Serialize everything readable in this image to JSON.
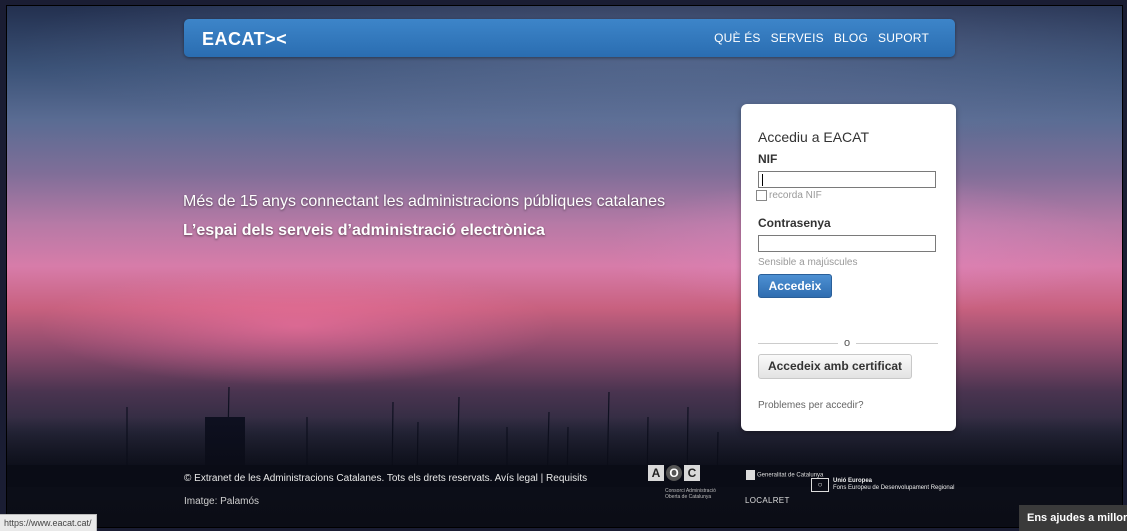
{
  "header": {
    "logo": "EACAT><",
    "nav": [
      "QUÈ ÉS",
      "SERVEIS",
      "BLOG",
      "SUPORT"
    ]
  },
  "hero": {
    "headline": "Més de 15 anys connectant les administracions públiques catalanes",
    "subheadline": "L’espai dels serveis d’administració electrònica"
  },
  "login": {
    "title": "Accediu a EACAT",
    "nif_label": "NIF",
    "nif_value": "",
    "remember_label": "recorda NIF",
    "password_label": "Contrasenya",
    "password_value": "",
    "case_hint": "Sensible a majúscules",
    "submit_label": "Accedeix",
    "divider_text": "o",
    "certificate_label": "Accedeix amb certificat",
    "problems_link": "Problemes per accedir?"
  },
  "footer": {
    "copyright": "© Extranet de les Administracions Catalanes. Tots els drets reservats.",
    "legal_link": "Avís legal",
    "separator": "|",
    "requisits_link": "Requisits",
    "image_label": "Imatge:",
    "image_credit": "Palamós",
    "aoc_sub": "Consorci Administració Oberta de Catalunya",
    "gencat": "Generalitat de Catalunya",
    "localret": "LOCALRET",
    "ue_title": "Unió Europea",
    "ue_fund": "Fons Europeu de Desenvolupament Regional"
  },
  "status_bar": {
    "url": "https://www.eacat.cat/"
  },
  "feedback": {
    "label": "Ens ajudes a millorar"
  },
  "colors": {
    "nav_blue": "#2a6db1",
    "button_blue": "#2f6db0"
  }
}
